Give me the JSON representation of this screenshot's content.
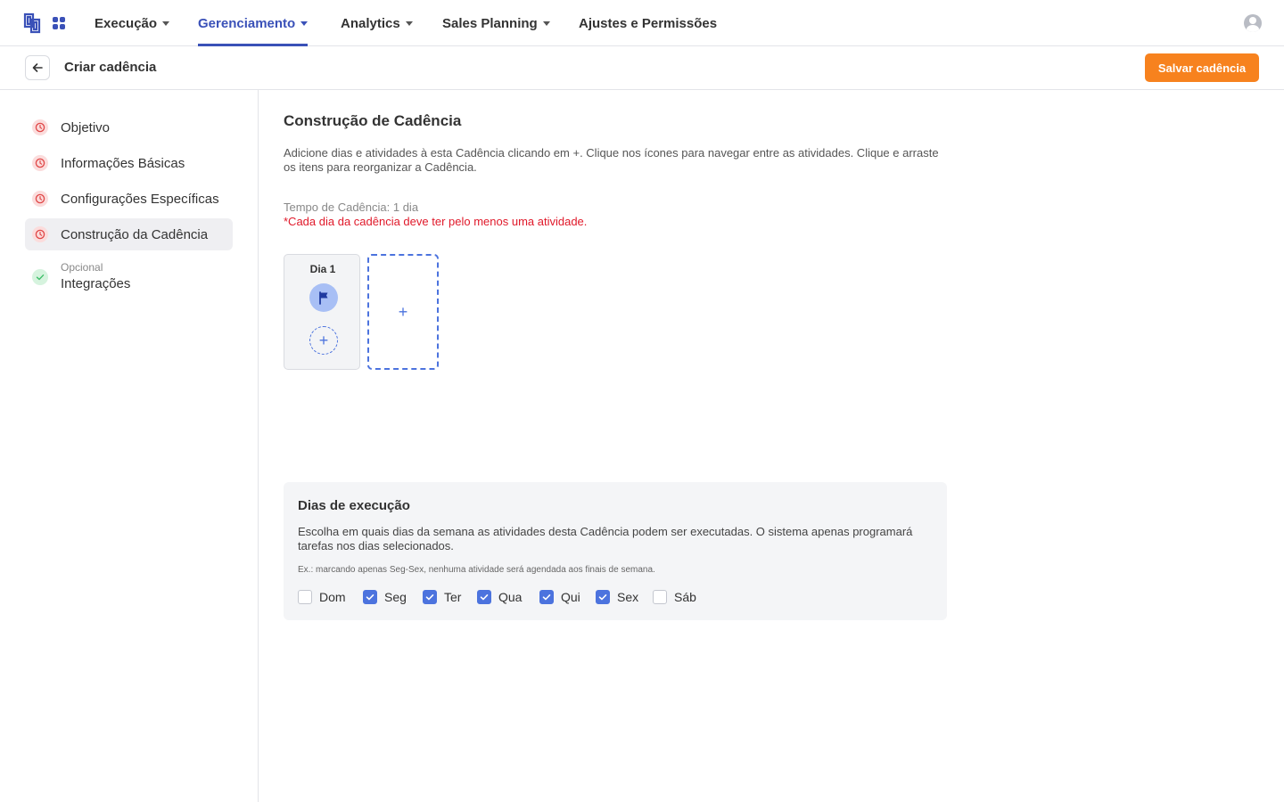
{
  "nav": {
    "items": [
      {
        "label": "Execução",
        "dropdown": true
      },
      {
        "label": "Gerenciamento",
        "dropdown": true,
        "active": true
      },
      {
        "label": "Analytics",
        "dropdown": true
      },
      {
        "label": "Sales Planning",
        "dropdown": true
      },
      {
        "label": "Ajustes e Permissões",
        "dropdown": false
      }
    ],
    "icons": {
      "logo": "brand-logo-icon",
      "apps": "apps-grid-icon",
      "user": "user-avatar-icon"
    }
  },
  "subheader": {
    "title": "Criar cadência",
    "save_label": "Salvar cadência",
    "back_icon": "arrow-left-icon"
  },
  "sidebar": {
    "steps": [
      {
        "label": "Objetivo",
        "status": "pending"
      },
      {
        "label": "Informações Básicas",
        "status": "pending"
      },
      {
        "label": "Configurações Específicas",
        "status": "pending"
      },
      {
        "label": "Construção da Cadência",
        "status": "pending",
        "active": true
      },
      {
        "label": "Integrações",
        "sub": "Opcional",
        "status": "done"
      }
    ]
  },
  "main": {
    "title": "Construção de Cadência",
    "description": "Adicione dias e atividades à esta Cadência clicando em +. Clique nos ícones para navegar entre as atividades. Clique e arraste os itens para reorganizar a Cadência.",
    "tempo": "Tempo de Cadência: 1 dia",
    "warning": "*Cada dia da cadência deve ter pelo menos uma atividade.",
    "days": [
      {
        "label": "Dia 1",
        "activities": [
          "flag-icon"
        ]
      }
    ],
    "add_symbol": "+"
  },
  "execution_days": {
    "title": "Dias de execução",
    "description": "Escolha em quais dias da semana as atividades desta Cadência podem ser executadas. O sistema apenas programará tarefas nos dias selecionados.",
    "example": "Ex.: marcando apenas Seg-Sex, nenhuma atividade será agendada aos finais de semana.",
    "days": [
      {
        "label": "Dom",
        "checked": false
      },
      {
        "label": "Seg",
        "checked": true
      },
      {
        "label": "Ter",
        "checked": true
      },
      {
        "label": "Qua",
        "checked": true
      },
      {
        "label": "Qui",
        "checked": true
      },
      {
        "label": "Sex",
        "checked": true
      },
      {
        "label": "Sáb",
        "checked": false
      }
    ]
  },
  "colors": {
    "brand": "#3a51b8",
    "accent_orange": "#f7821e",
    "warning_red": "#e0192a",
    "blue": "#4c73de",
    "pending": "#e04848",
    "done": "#3fbf6a"
  }
}
